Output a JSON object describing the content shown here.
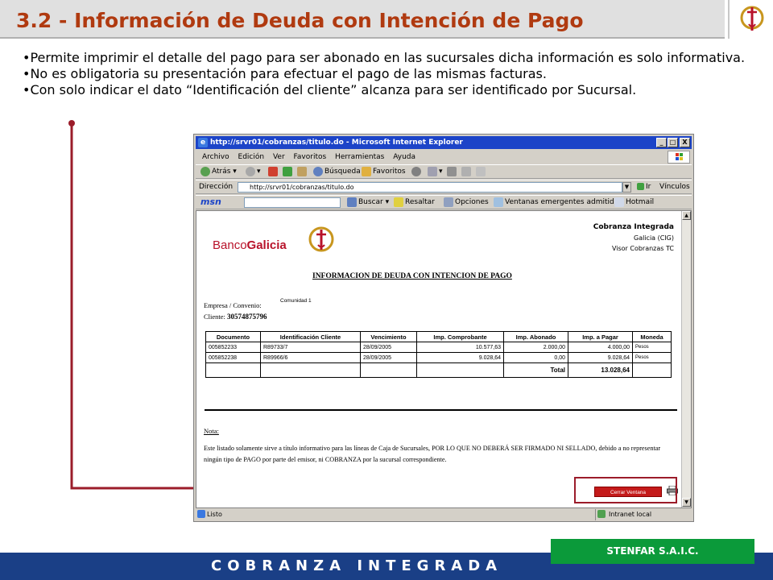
{
  "slide": {
    "title": "3.2 - Información de Deuda con Intención de Pago",
    "bullets": [
      "•Permite imprimir el detalle del pago para ser abonado en las sucursales dicha información es solo informativa.",
      "•No es obligatoria su presentación para efectuar el pago de las mismas facturas.",
      "•Con solo indicar el dato “Identificación  del cliente” alcanza para ser identificado por Sucursal."
    ],
    "footer_text": "COBRANZA INTEGRADA",
    "company_badge": "STENFAR S.A.I.C.",
    "accent_color": "#b03a10",
    "connector_color": "#9b1c2a",
    "footer_color": "#1a3f86",
    "badge_color": "#0b9a3a"
  },
  "browser": {
    "title": "http://srvr01/cobranzas/titulo.do - Microsoft Internet Explorer",
    "window_buttons": [
      "_",
      "□",
      "X"
    ],
    "menu": [
      "Archivo",
      "Edición",
      "Ver",
      "Favoritos",
      "Herramientas",
      "Ayuda"
    ],
    "toolbar": {
      "back": "Atrás",
      "search": "Búsqueda",
      "favorites": "Favoritos"
    },
    "address": {
      "label": "Dirección",
      "value": "http://srvr01/cobranzas/titulo.do",
      "go": "Ir",
      "links": "Vínculos"
    },
    "msn": {
      "logo": "msn",
      "search": "Buscar",
      "highlight": "Resaltar",
      "options": "Opciones",
      "popups": "Ventanas emergentes admitidas",
      "hotmail": "Hotmail"
    },
    "status": {
      "left": "Listo",
      "zone": "Intranet local"
    }
  },
  "report": {
    "bank_name_part1": "Banco",
    "bank_name_part2": "Galicia",
    "cig_lines": [
      "Cobranza Integrada",
      "Galicia (CIG)",
      "Visor Cobranzas TC"
    ],
    "title": "INFORMACION DE DEUDA CON INTENCION DE PAGO",
    "empresa_label": "Empresa / Convenio:",
    "empresa_value": "Comunidad 1",
    "cliente_label": "Cliente:",
    "cliente_value": "30574875796",
    "columns": [
      "Documento",
      "Identificación Cliente",
      "Vencimiento",
      "Imp. Comprobante",
      "Imp. Abonado",
      "Imp. a Pagar",
      "Moneda"
    ],
    "rows": [
      [
        "005852233",
        "R89733/7",
        "28/09/2005",
        "10.577,63",
        "2.000,00",
        "4.000,00",
        "Pesos"
      ],
      [
        "005852238",
        "R89966/6",
        "28/09/2005",
        "9.028,64",
        "0,00",
        "9.028,64",
        "Pesos"
      ]
    ],
    "total_label": "Total",
    "total_value": "13.028,64",
    "nota_label": "Nota:",
    "nota_text": "Este listado solamente sirve a título informativo para las líneas de Caja de Sucursales, POR LO QUE NO DEBERÁ SER FIRMADO NI SELLADO, debido a no representar ningún tipo de PAGO por parte del emisor, ni COBRANZA por la sucursal correspondiente.",
    "close_button": "Cerrar Ventana",
    "print_icon": "printer-icon"
  }
}
